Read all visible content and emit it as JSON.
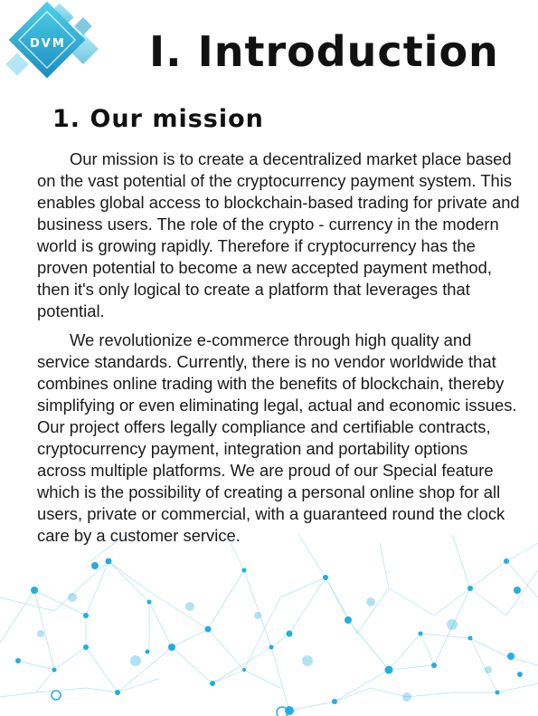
{
  "logo": {
    "text": "DVM"
  },
  "header": {
    "title": "I. Introduction"
  },
  "section": {
    "title": "1. Our mission",
    "paragraphs": [
      "Our mission is to create a decentralized market place based on the vast potential of the cryptocurrency payment system. This enables global access to blockchain-based trading for private and business users. The role of the crypto - currency in the modern world is growing rapidly. Therefore if cryptocurrency has the proven potential to become a new accepted payment method, then it's only logical to create a platform that leverages that potential.",
      "We revolutionize e-commerce through high quality and service standards. Currently, there is no vendor worldwide that combines online trading with the benefits of blockchain, thereby simplifying or even eliminating legal, actual and economic issues. Our project offers legally compliance and certifiable contracts, cryptocurrency payment, integration and portability options across multiple platforms. We are proud of our Special feature which is the possibility of creating a personal online shop for all users, private or commercial, with a guaranteed round the clock care by a customer service."
    ]
  },
  "colors": {
    "accent": "#2bb3d6",
    "accent_dark": "#1a8fb8",
    "network": "#22aee0"
  }
}
